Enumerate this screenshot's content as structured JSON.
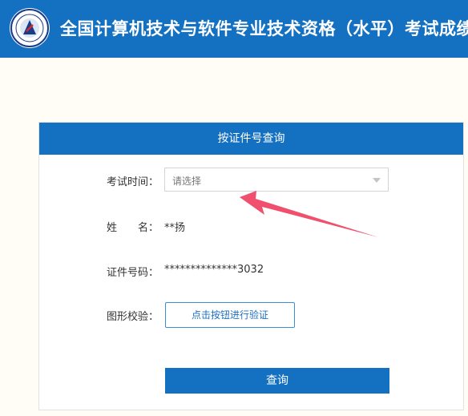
{
  "header": {
    "title": "全国计算机技术与软件专业技术资格（水平）考试成绩查",
    "logo_icon": "ruankao-seal-logo"
  },
  "panel": {
    "title": "按证件号查询",
    "exam_time": {
      "label": "考试时间：",
      "placeholder": "请选择"
    },
    "name": {
      "label": "姓　　名：",
      "value": "**扬"
    },
    "id_number": {
      "label": "证件号码：",
      "value": "**************3032"
    },
    "captcha": {
      "label": "图形校验：",
      "button": "点击按钮进行验证"
    },
    "submit_label": "查询"
  },
  "colors": {
    "primary": "#1470c0",
    "annotation_arrow": "#f0506e"
  }
}
